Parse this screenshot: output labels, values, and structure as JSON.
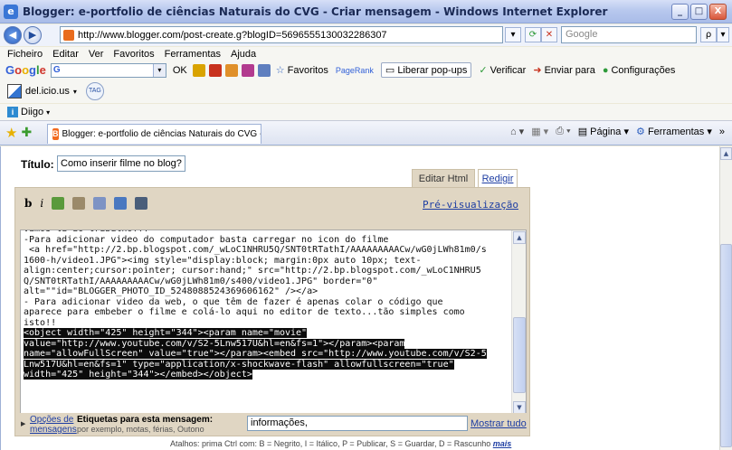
{
  "window": {
    "title": "Blogger: e-portfolio de ciências Naturais do CVG - Criar mensagem - Windows Internet Explorer",
    "app_icon": "e",
    "controls": {
      "minimize": "_",
      "maximize": "□",
      "close": "X"
    }
  },
  "address": {
    "url": "http://www.blogger.com/post-create.g?blogID=5696555130032286307",
    "search_placeholder": "Google",
    "search_button": "ρ"
  },
  "menu": [
    "Ficheiro",
    "Editar",
    "Ver",
    "Favoritos",
    "Ferramentas",
    "Ajuda"
  ],
  "google_toolbar": {
    "ok": "OK",
    "favoritos": "Favoritos",
    "pagerank": "PageRank",
    "liberar_popups": "Liberar pop-ups",
    "verificar": "Verificar",
    "enviar_para": "Enviar para",
    "configuracoes": "Configurações"
  },
  "delicious": {
    "label": "del.icio.us",
    "tag": "TAG"
  },
  "diigo": {
    "label": "Diigo"
  },
  "tabs": {
    "active_tab": "Blogger: e-portfolio de ciências Naturais do CVG - Cria...",
    "pagina": "Página",
    "ferramentas": "Ferramentas"
  },
  "post": {
    "title_label": "Título:",
    "title_value": "Como inserir filme no blog?",
    "tab_html": "Editar Html",
    "tab_compose": "Redigir",
    "preview": "Pré-visualização",
    "bold": "b",
    "italic": "i"
  },
  "editor": {
    "lines": [
      "vamos lá ao trabalho!!!",
      "-Para adicionar video do computador basta carregar no icon do filme",
      " <a href=\"http://2.bp.blogspot.com/_wLoC1NHRU5Q/SNT0tRTathI/AAAAAAAAACw/wG0jLWh81m0/s",
      "1600-h/video1.JPG\"><img style=\"display:block; margin:0px auto 10px; text-",
      "align:center;cursor:pointer; cursor:hand;\" src=\"http://2.bp.blogspot.com/_wLoC1NHRU5",
      "Q/SNT0tRTathI/AAAAAAAAACw/wG0jLWh81m0/s400/video1.JPG\" border=\"0\"",
      "alt=\"\"id=\"BLOGGER_PHOTO_ID_5248088524369606162\" /></a>",
      "- Para adicionar video da web, o que têm de fazer é apenas colar o código que",
      "aparece para embeber o filme e colá-lo aqui no editor de texto...tão simples como",
      "isto!!"
    ],
    "selected_lines": [
      "<object width=\"425\" height=\"344\"><param name=\"movie\"",
      "value=\"http://www.youtube.com/v/S2-5Lnw517U&hl=en&fs=1\"></param><param",
      "name=\"allowFullScreen\" value=\"true\"></param><embed src=\"http://www.youtube.com/v/S2-5",
      "Lnw517U&hl=en&fs=1\" type=\"application/x-shockwave-flash\" allowfullscreen=\"true\"",
      "width=\"425\" height=\"344\"></embed></object>"
    ]
  },
  "labels": {
    "opcoes_link": "Opções de",
    "mensagens_link": "mensagens",
    "etiquetas_label": "Etiquetas para esta mensagem:",
    "etiquetas_hint": "por exemplo, motas, férias, Outono",
    "etiquetas_value": "informações,",
    "mostrar_tudo": "Mostrar tudo"
  },
  "shortcuts": {
    "text": "Atalhos: prima Ctrl com: B = Negrito, I = Itálico, P = Publicar, S = Guardar, D = Rascunho",
    "more": "mais"
  }
}
